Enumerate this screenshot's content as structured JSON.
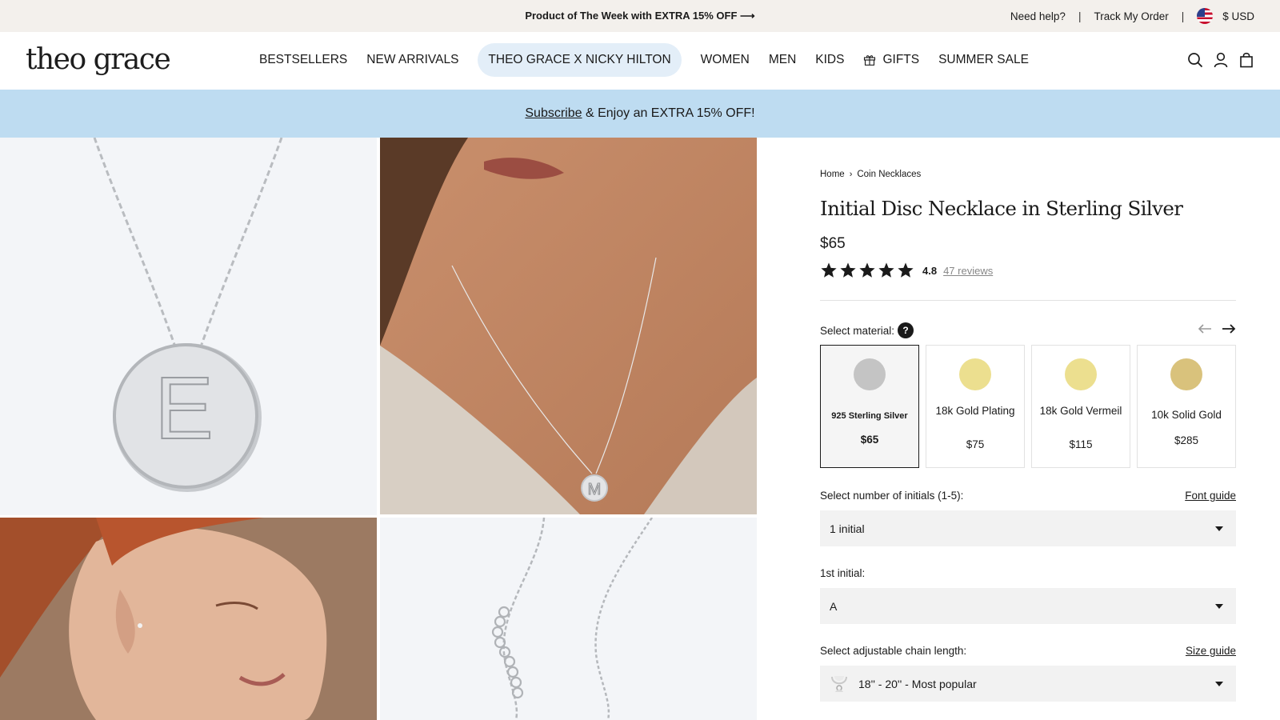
{
  "topbar": {
    "promo": "Product of The Week with EXTRA 15% OFF ⟶",
    "help": "Need help?",
    "track": "Track My Order",
    "currency": "$ USD"
  },
  "header": {
    "logo": "theo grace",
    "nav": [
      {
        "label": "BESTSELLERS"
      },
      {
        "label": "NEW ARRIVALS"
      },
      {
        "label": "THEO GRACE X NICKY HILTON"
      },
      {
        "label": "WOMEN"
      },
      {
        "label": "MEN"
      },
      {
        "label": "KIDS"
      },
      {
        "label": "GIFTS"
      },
      {
        "label": "SUMMER SALE"
      }
    ],
    "icons": [
      "search-icon",
      "account-icon",
      "bag-icon"
    ]
  },
  "subscribe": {
    "link": "Subscribe",
    "text": " & Enjoy an EXTRA 15% OFF!"
  },
  "gallery": {
    "disc_letter": "E",
    "worn_letter": "M"
  },
  "product": {
    "breadcrumb": [
      "Home",
      "Coin Necklaces"
    ],
    "title": "Initial Disc Necklace in Sterling Silver",
    "price": "$65",
    "rating": "4.8",
    "stars": 5,
    "reviews": "47 reviews",
    "material_label": "Select material:",
    "material_help": "?",
    "materials": [
      {
        "name": "925 Sterling Silver",
        "price": "$65",
        "color": "#c4c4c4",
        "selected": true
      },
      {
        "name": "18k Gold Plating",
        "price": "$75",
        "color": "#ecdf8f",
        "selected": false
      },
      {
        "name": "18k Gold Vermeil",
        "price": "$115",
        "color": "#ecdf8f",
        "selected": false
      },
      {
        "name": "10k Solid Gold",
        "price": "$285",
        "color": "#d9c27c",
        "selected": false
      }
    ],
    "initials_label": "Select number of initials (1-5):",
    "font_guide": "Font guide",
    "initials_value": "1 initial",
    "first_initial_label": "1st initial:",
    "first_initial_value": "A",
    "chain_label": "Select adjustable chain length:",
    "size_guide": "Size guide",
    "chain_value": "18'' - 20'' - Most popular"
  }
}
